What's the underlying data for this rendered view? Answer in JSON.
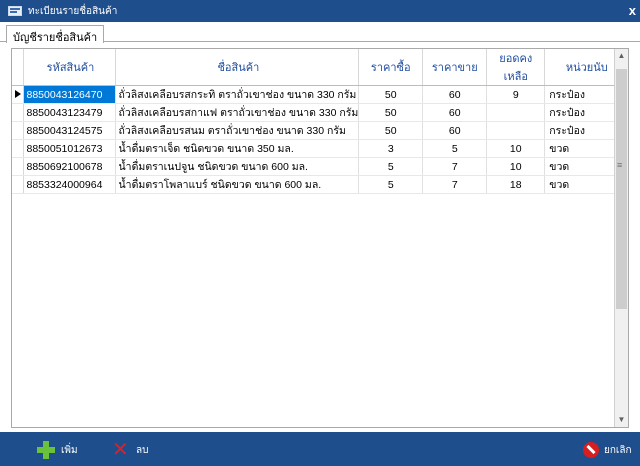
{
  "window": {
    "title": "ทะเบียนรายชื่อสินค้า",
    "close_glyph": "x"
  },
  "tabs": [
    {
      "label": "บัญชีรายชื่อสินค้า"
    }
  ],
  "grid": {
    "columns": [
      "รหัสสินค้า",
      "ชื่อสินค้า",
      "ราคาซื้อ",
      "ราคาขาย",
      "ยอดคงเหลือ",
      "หน่วยนับ"
    ],
    "rows": [
      {
        "code": "8850043126470",
        "name": "ถั่วลิสงเคลือบรสกระทิ ตราถั่วเขาช่อง ขนาด 330 กรัม",
        "buy": "50",
        "sell": "60",
        "stock": "9",
        "unit": "กระป๋อง"
      },
      {
        "code": "8850043123479",
        "name": "ถั่วลิสงเคลือบรสกาแฟ ตราถั่วเขาช่อง ขนาด 330 กรัม",
        "buy": "50",
        "sell": "60",
        "stock": "",
        "unit": "กระป๋อง"
      },
      {
        "code": "8850043124575",
        "name": "ถั่วลิสงเคลือบรสนม ตราถั่วเขาช่อง ขนาด 330 กรัม",
        "buy": "50",
        "sell": "60",
        "stock": "",
        "unit": "กระป๋อง"
      },
      {
        "code": "8850051012673",
        "name": "น้ำดื่มตราเจ็ด ชนิดขวด ขนาด 350 มล.",
        "buy": "3",
        "sell": "5",
        "stock": "10",
        "unit": "ขวด"
      },
      {
        "code": "8850692100678",
        "name": "น้ำดื่มตราเนปจูน ชนิดขวด ขนาด 600 มล.",
        "buy": "5",
        "sell": "7",
        "stock": "10",
        "unit": "ขวด"
      },
      {
        "code": "8853324000964",
        "name": "น้ำดื่มตราโพลาแบร์ ชนิดขวด ขนาด 600 มล.",
        "buy": "5",
        "sell": "7",
        "stock": "18",
        "unit": "ขวด"
      }
    ]
  },
  "toolbar": {
    "add_label": "เพิ่ม",
    "delete_label": "ลบ",
    "cancel_label": "ยกเลิก"
  },
  "colors": {
    "titlebar": "#1f4e8c",
    "selection": "#0078d7",
    "header_text": "#1f4ea0"
  }
}
